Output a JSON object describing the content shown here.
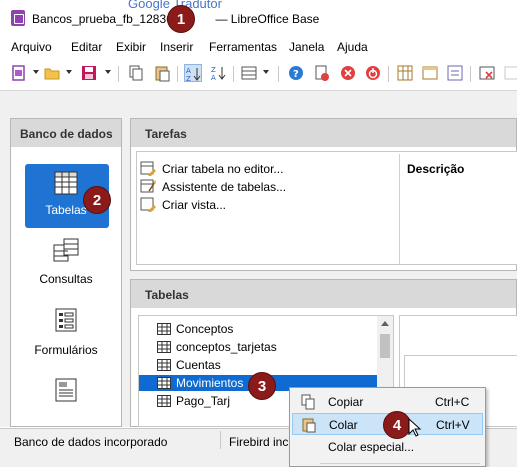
{
  "window": {
    "title": "Bancos_prueba_fb_128361",
    "title_suffix": "— LibreOffice Base",
    "background_fragment": "Google Tradutor"
  },
  "menu": [
    "Arquivo",
    "Editar",
    "Exibir",
    "Inserir",
    "Ferramentas",
    "Janela",
    "Ajuda"
  ],
  "toolbar": {
    "icons": [
      "new-icon",
      "open-icon",
      "save-icon",
      "copy-icon",
      "paste-icon",
      "sort-ascending-icon",
      "sort-descending-icon",
      "table-view-icon",
      "help-icon",
      "close-doc-icon",
      "stop-icon",
      "power-icon",
      "grid-icon",
      "form-icon",
      "report-icon",
      "delete-icon"
    ]
  },
  "left_panel": {
    "header": "Banco de dados",
    "items": [
      {
        "label": "Tabelas",
        "icon": "table-icon",
        "selected": true
      },
      {
        "label": "Consultas",
        "icon": "query-icon",
        "selected": false
      },
      {
        "label": "Formulários",
        "icon": "form-icon",
        "selected": false
      },
      {
        "label": "",
        "icon": "report-icon",
        "selected": false
      }
    ]
  },
  "tasks": {
    "header": "Tarefas",
    "items": [
      "Criar tabela no editor...",
      "Assistente de tabelas...",
      "Criar vista..."
    ],
    "description_label": "Descrição"
  },
  "tables": {
    "header": "Tabelas",
    "rows": [
      "Conceptos",
      "conceptos_tarjetas",
      "Cuentas",
      "Movimientos",
      "Pago_Tarj"
    ],
    "selected_index": 3
  },
  "context_menu": {
    "items": [
      {
        "label": "Copiar",
        "shortcut": "Ctrl+C",
        "highlighted": false
      },
      {
        "label": "Colar",
        "shortcut": "Ctrl+V",
        "highlighted": true
      },
      {
        "label": "Colar especial...",
        "shortcut": "",
        "highlighted": false
      }
    ]
  },
  "status": {
    "left": "Banco de dados incorporado",
    "right": "Firebird inc"
  },
  "badges": [
    "1",
    "2",
    "3",
    "4"
  ],
  "colors": {
    "accent": "#1f73d2",
    "badge": "#8b1a1a",
    "highlight": "#cce4f7"
  }
}
